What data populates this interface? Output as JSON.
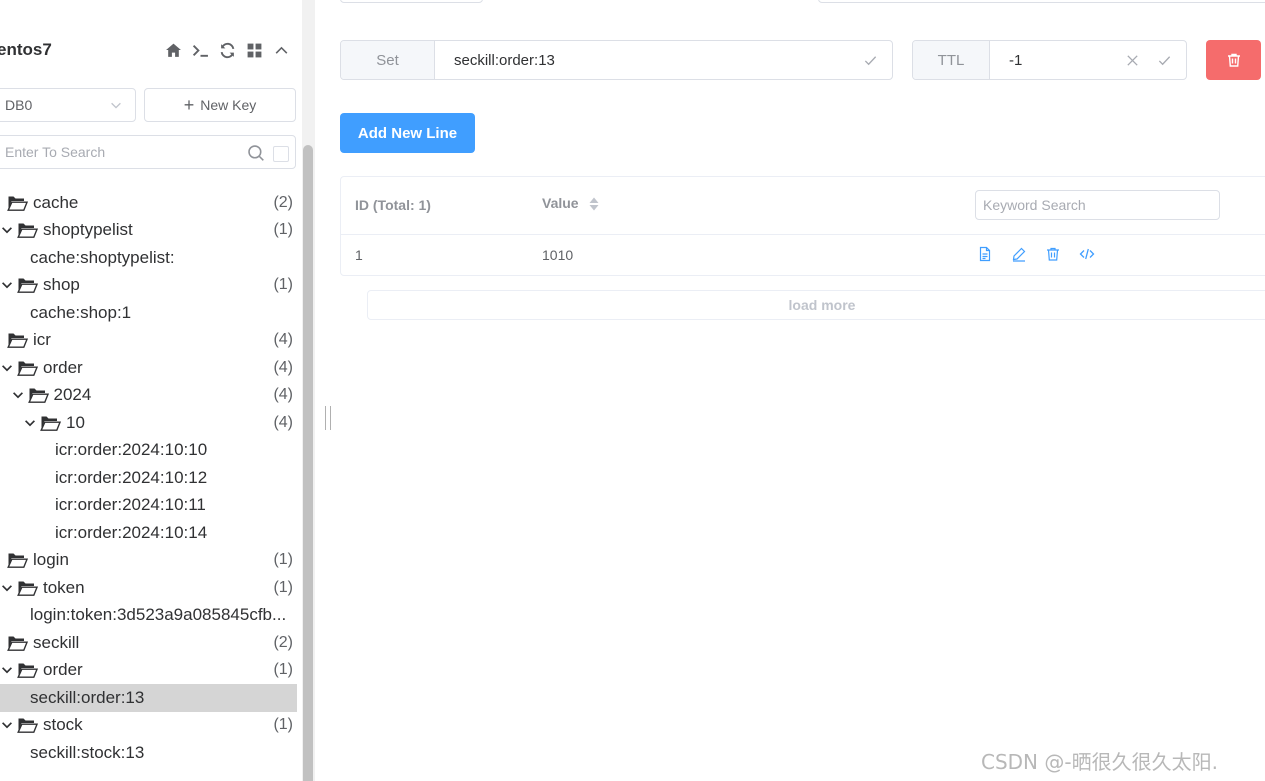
{
  "connection": {
    "name": "entos7"
  },
  "toolbar": {
    "new_key_label": "New Key"
  },
  "db_select": {
    "value": "DB0"
  },
  "search": {
    "placeholder": "Enter To Search"
  },
  "tree": [
    {
      "type": "folder",
      "label": "cache",
      "count": "(2)",
      "depth": 0,
      "arrow": false
    },
    {
      "type": "folder",
      "label": "shoptypelist",
      "count": "(1)",
      "depth": 1,
      "arrow": true
    },
    {
      "type": "leaf",
      "label": "cache:shoptypelist:",
      "depth": 2
    },
    {
      "type": "folder",
      "label": "shop",
      "count": "(1)",
      "depth": 1,
      "arrow": true
    },
    {
      "type": "leaf",
      "label": "cache:shop:1",
      "depth": 2
    },
    {
      "type": "folder",
      "label": "icr",
      "count": "(4)",
      "depth": 0,
      "arrow": false
    },
    {
      "type": "folder",
      "label": "order",
      "count": "(4)",
      "depth": 1,
      "arrow": true
    },
    {
      "type": "folder",
      "label": "2024",
      "count": "(4)",
      "depth": 2,
      "arrow": true
    },
    {
      "type": "folder",
      "label": "10",
      "count": "(4)",
      "depth": 3,
      "arrow": true
    },
    {
      "type": "leaf",
      "label": "icr:order:2024:10:10",
      "depth": 4
    },
    {
      "type": "leaf",
      "label": "icr:order:2024:10:12",
      "depth": 4
    },
    {
      "type": "leaf",
      "label": "icr:order:2024:10:11",
      "depth": 4
    },
    {
      "type": "leaf",
      "label": "icr:order:2024:10:14",
      "depth": 4
    },
    {
      "type": "folder",
      "label": "login",
      "count": "(1)",
      "depth": 0,
      "arrow": false
    },
    {
      "type": "folder",
      "label": "token",
      "count": "(1)",
      "depth": 1,
      "arrow": true
    },
    {
      "type": "leaf",
      "label": "login:token:3d523a9a085845cfb...",
      "depth": 2
    },
    {
      "type": "folder",
      "label": "seckill",
      "count": "(2)",
      "depth": 0,
      "arrow": false
    },
    {
      "type": "folder",
      "label": "order",
      "count": "(1)",
      "depth": 1,
      "arrow": true
    },
    {
      "type": "leaf",
      "label": "seckill:order:13",
      "depth": 2,
      "selected": true
    },
    {
      "type": "folder",
      "label": "stock",
      "count": "(1)",
      "depth": 1,
      "arrow": true
    },
    {
      "type": "leaf",
      "label": "seckill:stock:13",
      "depth": 2
    }
  ],
  "key": {
    "type_label": "Set",
    "name": "seckill:order:13"
  },
  "ttl": {
    "label": "TTL",
    "value": "-1"
  },
  "actions": {
    "add_new_line": "Add New Line"
  },
  "table": {
    "columns": {
      "id": "ID (Total: 1)",
      "value": "Value"
    },
    "keyword_placeholder": "Keyword Search",
    "rows": [
      {
        "id": "1",
        "value": "1010"
      }
    ],
    "load_more": "load more"
  },
  "colors": {
    "primary": "#409eff",
    "danger": "#f56c6c",
    "selected_row": "#d5d5d5"
  },
  "watermark": "CSDN @-晒很久很久太阳."
}
